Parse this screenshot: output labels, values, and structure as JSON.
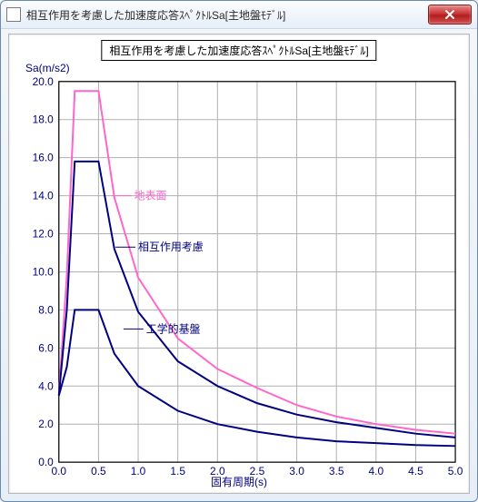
{
  "window": {
    "title": "相互作用を考慮した加速度応答ｽﾍﾟｸﾄﾙSa[主地盤ﾓﾃﾞﾙ]"
  },
  "chart_data": {
    "type": "line",
    "title": "相互作用を考慮した加速度応答ｽﾍﾟｸﾄﾙSa[主地盤ﾓﾃﾞﾙ]",
    "xlabel": "固有周期(s)",
    "ylabel": "Sa(m/s2)",
    "xlim": [
      0.0,
      5.0
    ],
    "ylim": [
      0.0,
      20.0
    ],
    "xticks": [
      0.0,
      0.5,
      1.0,
      1.5,
      2.0,
      2.5,
      3.0,
      3.5,
      4.0,
      4.5,
      5.0
    ],
    "yticks": [
      0.0,
      2.0,
      4.0,
      6.0,
      8.0,
      10.0,
      12.0,
      14.0,
      16.0,
      18.0,
      20.0
    ],
    "series": [
      {
        "name": "地表面",
        "color": "#ff66cc",
        "label_at": [
          0.95,
          14.0
        ],
        "x": [
          0.0,
          0.1,
          0.2,
          0.3,
          0.5,
          0.7,
          1.0,
          1.5,
          2.0,
          2.5,
          3.0,
          3.5,
          4.0,
          4.5,
          5.0
        ],
        "y": [
          3.5,
          9.8,
          19.5,
          19.5,
          19.5,
          13.9,
          9.7,
          6.5,
          4.9,
          3.9,
          3.0,
          2.4,
          2.0,
          1.7,
          1.5
        ]
      },
      {
        "name": "相互作用考慮",
        "color": "#000080",
        "label_at": [
          1.0,
          11.3
        ],
        "x": [
          0.0,
          0.1,
          0.2,
          0.3,
          0.5,
          0.7,
          1.0,
          1.5,
          2.0,
          2.5,
          3.0,
          3.5,
          4.0,
          4.5,
          5.0
        ],
        "y": [
          3.5,
          8.0,
          15.8,
          15.8,
          15.8,
          11.2,
          7.9,
          5.3,
          4.0,
          3.1,
          2.5,
          2.1,
          1.8,
          1.5,
          1.3
        ]
      },
      {
        "name": "工学的基盤",
        "color": "#000080",
        "label_at": [
          1.1,
          7.0
        ],
        "x": [
          0.0,
          0.1,
          0.2,
          0.3,
          0.5,
          0.7,
          1.0,
          1.5,
          2.0,
          2.5,
          3.0,
          3.5,
          4.0,
          4.5,
          5.0
        ],
        "y": [
          3.5,
          5.0,
          8.0,
          8.0,
          8.0,
          5.7,
          4.0,
          2.7,
          2.0,
          1.6,
          1.3,
          1.1,
          1.0,
          0.9,
          0.85
        ]
      }
    ]
  }
}
